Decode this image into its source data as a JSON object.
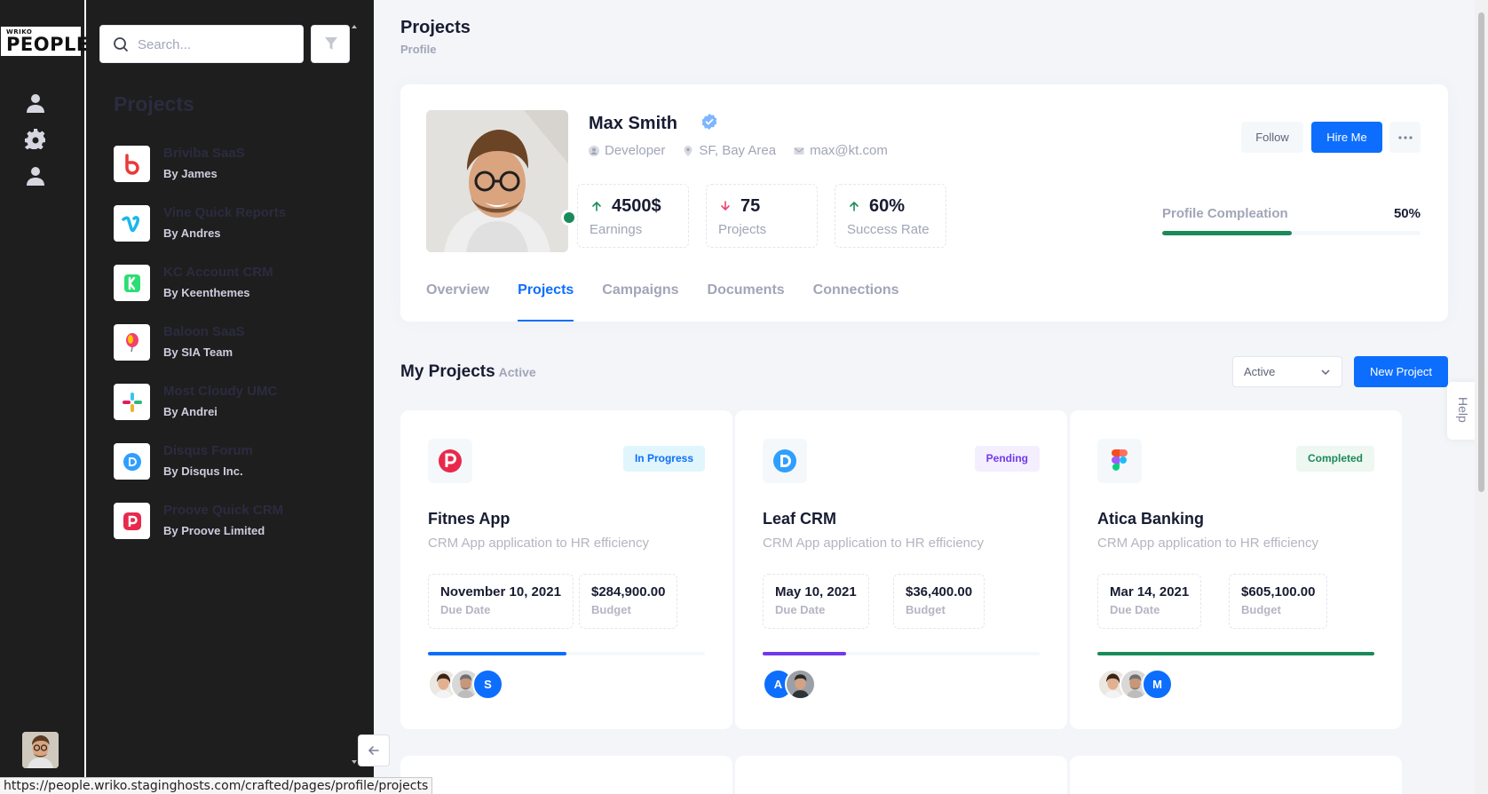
{
  "brand": {
    "small": "WRIKO",
    "big": "PEOPLE"
  },
  "search": {
    "placeholder": "Search..."
  },
  "aside": {
    "heading": "Projects",
    "items": [
      {
        "name": "Briviba SaaS",
        "by": "By James",
        "logo": "briviba-logo",
        "color": "#e83a3a"
      },
      {
        "name": "Vine Quick Reports",
        "by": "By Andres",
        "logo": "vimeo-logo",
        "color": "#1ab7ea"
      },
      {
        "name": "KC Account CRM",
        "by": "By Keenthemes",
        "logo": "kickstarter-logo",
        "color": "#2bde73"
      },
      {
        "name": "Baloon SaaS",
        "by": "By SIA Team",
        "logo": "balloon-logo",
        "color": "#f1416c"
      },
      {
        "name": "Most Cloudy UMC",
        "by": "By Andrei",
        "logo": "slack-logo",
        "color": "#4a154b"
      },
      {
        "name": "Disqus Forum",
        "by": "By Disqus Inc.",
        "logo": "disqus-logo",
        "color": "#2e9fff"
      },
      {
        "name": "Proove Quick CRM",
        "by": "By Proove Limited",
        "logo": "proove-logo",
        "color": "#e8294c"
      }
    ]
  },
  "page": {
    "title": "Projects",
    "breadcrumb": "Profile"
  },
  "profile": {
    "name": "Max Smith",
    "role": "Developer",
    "location": "SF, Bay Area",
    "email": "max@kt.com",
    "stats": [
      {
        "value": "4500$",
        "label": "Earnings",
        "trend": "up"
      },
      {
        "value": "75",
        "label": "Projects",
        "trend": "down"
      },
      {
        "value": "60%",
        "label": "Success Rate",
        "trend": "up"
      }
    ],
    "follow_label": "Follow",
    "hire_label": "Hire Me",
    "completion_label": "Profile Compleation",
    "completion_value": "50%",
    "completion_fraction": 0.5
  },
  "tabs": [
    {
      "label": "Overview",
      "active": false
    },
    {
      "label": "Projects",
      "active": true
    },
    {
      "label": "Campaigns",
      "active": false
    },
    {
      "label": "Documents",
      "active": false
    },
    {
      "label": "Connections",
      "active": false
    }
  ],
  "projects_section": {
    "title": "My Projects",
    "subtitle": "Active",
    "filter_value": "Active",
    "new_label": "New Project"
  },
  "help_label": "Help",
  "projects": [
    {
      "title": "Fitnes App",
      "description": "CRM App application to HR efficiency",
      "status": "In Progress",
      "status_kind": "progress",
      "logo": "proove-logo",
      "due_date": "November 10, 2021",
      "due_label": "Due Date",
      "budget": "$284,900.00",
      "budget_label": "Budget",
      "progress": 0.5,
      "progress_color": "#0d6efd",
      "avatars": [
        {
          "type": "face"
        },
        {
          "type": "face"
        },
        {
          "type": "letter",
          "letter": "S",
          "color": "#0d6efd"
        }
      ]
    },
    {
      "title": "Leaf CRM",
      "description": "CRM App application to HR efficiency",
      "status": "Pending",
      "status_kind": "pending",
      "logo": "disqus-logo",
      "due_date": "May 10, 2021",
      "due_label": "Due Date",
      "budget": "$36,400.00",
      "budget_label": "Budget",
      "progress": 0.3,
      "progress_color": "#7239ea",
      "avatars": [
        {
          "type": "letter",
          "letter": "A",
          "color": "#0d6efd"
        },
        {
          "type": "face"
        }
      ]
    },
    {
      "title": "Atica Banking",
      "description": "CRM App application to HR efficiency",
      "status": "Completed",
      "status_kind": "completed",
      "logo": "figma-logo",
      "due_date": "Mar 14, 2021",
      "due_label": "Due Date",
      "budget": "$605,100.00",
      "budget_label": "Budget",
      "progress": 1.0,
      "progress_color": "#1b8a5a",
      "avatars": [
        {
          "type": "face"
        },
        {
          "type": "face"
        },
        {
          "type": "letter",
          "letter": "M",
          "color": "#0d6efd"
        }
      ]
    }
  ],
  "status_url": "https://people.wriko.staginghosts.com/crafted/pages/profile/projects"
}
